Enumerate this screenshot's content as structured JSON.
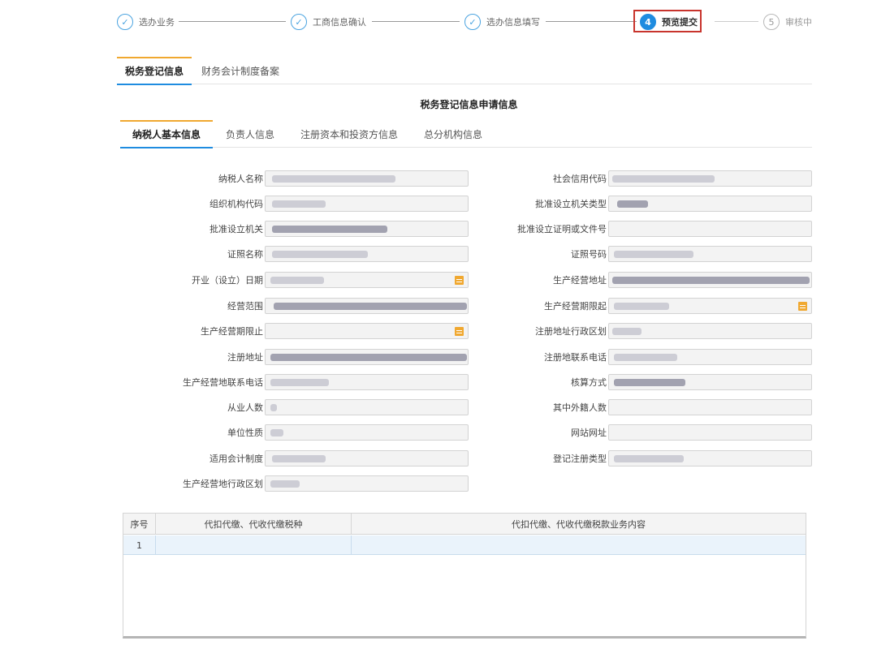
{
  "stepper": {
    "steps": [
      {
        "index": "✓",
        "label": "选办业务",
        "state": "done"
      },
      {
        "index": "✓",
        "label": "工商信息确认",
        "state": "done"
      },
      {
        "index": "✓",
        "label": "选办信息填写",
        "state": "done"
      },
      {
        "index": "4",
        "label": "预览提交",
        "state": "active"
      },
      {
        "index": "5",
        "label": "审核中",
        "state": "pending"
      }
    ]
  },
  "top_tabs": [
    {
      "label": "税务登记信息",
      "active": true
    },
    {
      "label": "财务会计制度备案",
      "active": false
    }
  ],
  "section_title": "税务登记信息申请信息",
  "sub_tabs": [
    {
      "label": "纳税人基本信息",
      "active": true
    },
    {
      "label": "负责人信息",
      "active": false
    },
    {
      "label": "注册资本和投资方信息",
      "active": false
    },
    {
      "label": "总分机构信息",
      "active": false
    }
  ],
  "form": {
    "left": [
      {
        "label": "纳税人名称"
      },
      {
        "label": "组织机构代码"
      },
      {
        "label": "批准设立机关"
      },
      {
        "label": "证照名称"
      },
      {
        "label": "开业（设立）日期",
        "calendar": true
      },
      {
        "label": "经营范围"
      },
      {
        "label": "生产经营期限止",
        "calendar": true
      },
      {
        "label": "注册地址"
      },
      {
        "label": "生产经营地联系电话"
      },
      {
        "label": "从业人数"
      },
      {
        "label": "单位性质"
      },
      {
        "label": "适用会计制度"
      },
      {
        "label": "生产经营地行政区划"
      }
    ],
    "right": [
      {
        "label": "社会信用代码"
      },
      {
        "label": "批准设立机关类型"
      },
      {
        "label": "批准设立证明或文件号"
      },
      {
        "label": "证照号码"
      },
      {
        "label": "生产经营地址"
      },
      {
        "label": "生产经营期限起",
        "calendar": true
      },
      {
        "label": "注册地址行政区划"
      },
      {
        "label": "注册地联系电话"
      },
      {
        "label": "核算方式"
      },
      {
        "label": "其中外籍人数"
      },
      {
        "label": "网站网址"
      },
      {
        "label": "登记注册类型"
      }
    ]
  },
  "table": {
    "columns": [
      "序号",
      "代扣代缴、代收代缴税种",
      "代扣代缴、代收代缴税款业务内容"
    ],
    "rows": [
      [
        "1",
        "",
        ""
      ]
    ]
  },
  "colors": {
    "accent": "#1f8ce0",
    "tab_top": "#f0a830",
    "highlight": "#c8342d"
  }
}
